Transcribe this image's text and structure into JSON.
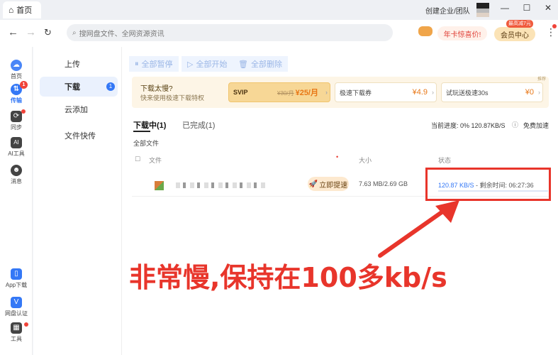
{
  "titlebar": {
    "tab_label": "首页",
    "team_label": "创建企业/团队",
    "min": "—",
    "max": "☐",
    "close": "✕"
  },
  "nav": {
    "search_placeholder": "搜网盘文件、全网资源资讯",
    "promo_label": "年卡惊喜价!",
    "vip_label": "会员中心",
    "vip_tag": "最高减7元"
  },
  "rail": {
    "items": [
      {
        "label": "首页"
      },
      {
        "label": "传输",
        "badge": "1"
      },
      {
        "label": "同步"
      },
      {
        "label": "AI工具"
      },
      {
        "label": "消息"
      },
      {
        "label": "App下载"
      },
      {
        "label": "网盘认证"
      },
      {
        "label": "工具"
      }
    ]
  },
  "subnav": {
    "items": [
      {
        "label": "上传"
      },
      {
        "label": "下载",
        "badge": "1"
      },
      {
        "label": "云添加"
      },
      {
        "label": "文件快传"
      }
    ]
  },
  "toolbar": {
    "pause_all": "全部暂停",
    "start_all": "全部开始",
    "delete_all": "全部删除"
  },
  "promo": {
    "title": "下载太慢?",
    "subtitle": "快来使用极速下载特权",
    "ad_tag": "推荐",
    "cards": [
      {
        "label": "SVIP",
        "old_price": "¥30/月",
        "price": "¥25/月"
      },
      {
        "label": "极速下载券",
        "price": "¥4.9"
      },
      {
        "label": "试玩送极速30s",
        "price": "¥0"
      }
    ]
  },
  "download": {
    "tab_downloading": "下载中(1)",
    "tab_completed": "已完成(1)",
    "progress_info": "当前进度: 0%  120.87KB/S",
    "accel_label": "免费加速",
    "all_files": "全部文件",
    "col_file": "文件",
    "col_size": "大小",
    "col_status": "状态",
    "row": {
      "boost_label": "立即提速",
      "size": "7.63 MB/2.69 GB",
      "speed": "120.87 KB/S",
      "remaining": " - 剩余时间: 06:27:36"
    }
  },
  "annotation": {
    "text": "非常慢,保持在100多kb/s"
  },
  "colors": {
    "accent": "#3478f6",
    "annotation_red": "#e8352b"
  }
}
